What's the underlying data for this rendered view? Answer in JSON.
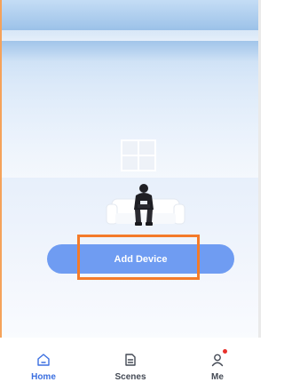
{
  "main": {
    "add_device_label": "Add Device"
  },
  "bottom_nav": {
    "items": [
      {
        "label": "Home",
        "icon": "home-icon",
        "active": true
      },
      {
        "label": "Scenes",
        "icon": "scenes-icon",
        "active": false
      },
      {
        "label": "Me",
        "icon": "person-icon",
        "active": false,
        "badge": true
      }
    ]
  },
  "colors": {
    "accent": "#3b6fe0",
    "button": "#6f9cf2",
    "highlight": "#f47b2a",
    "badge": "#e8322c"
  }
}
